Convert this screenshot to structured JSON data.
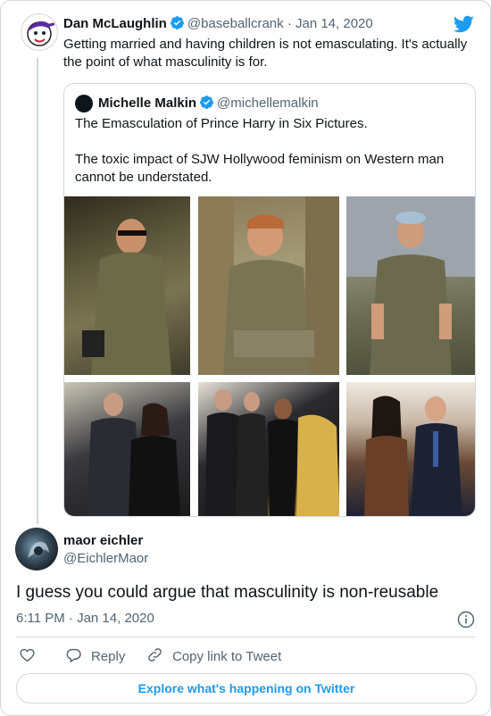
{
  "tweet": {
    "author_name": "Dan McLaughlin",
    "author_handle": "@baseballcrank",
    "date": "· Jan 14, 2020",
    "text": "Getting married and having children is not emasculating. It's actually the point of what masculinity is for."
  },
  "quoted": {
    "author_name": "Michelle Malkin",
    "author_handle": "@michellemalkin",
    "line1": "The Emasculation of Prince Harry in Six Pictures.",
    "line2": "The toxic impact of SJW Hollywood feminism on Western man cannot be understated.",
    "photo_count": 6
  },
  "reply": {
    "author_name": "maor eichler",
    "author_handle": "@EichlerMaor",
    "text": "I guess you could argue that masculinity is non-reusable",
    "timestamp": "6:11 PM · Jan 14, 2020"
  },
  "actions": {
    "reply_label": "Reply",
    "copy_label": "Copy link to Tweet"
  },
  "explore_label": "Explore what's happening on Twitter",
  "colors": {
    "accent": "#1d9bf0",
    "text": "#0f1419",
    "muted": "#536471",
    "border": "#cfd9de"
  },
  "icons": [
    "verified-badge-icon",
    "twitter-bird-icon",
    "heart-icon",
    "reply-icon",
    "link-icon",
    "info-icon"
  ]
}
